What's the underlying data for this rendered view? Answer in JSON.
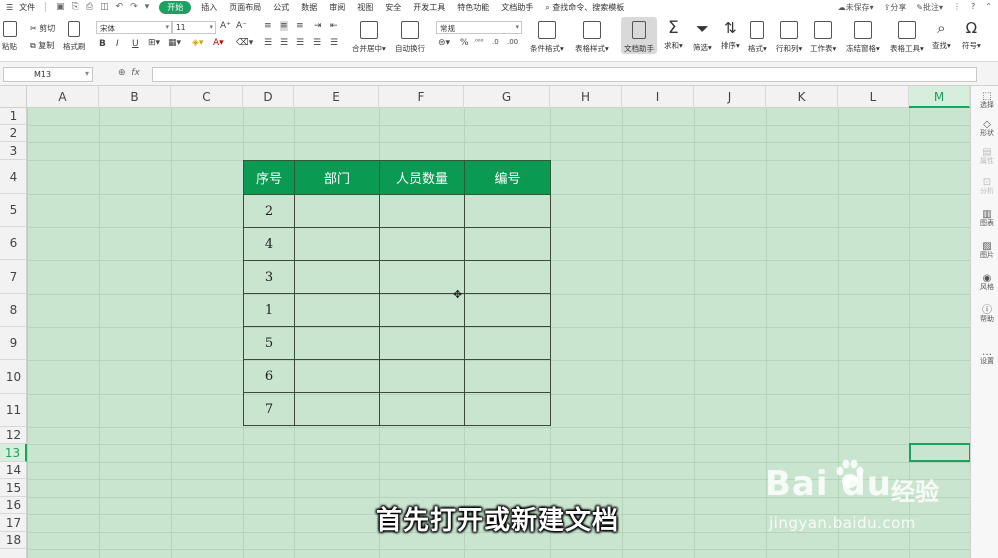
{
  "menubar": {
    "file": "文件",
    "tabs": [
      "开始",
      "插入",
      "页面布局",
      "公式",
      "数据",
      "审阅",
      "视图",
      "安全",
      "开发工具",
      "特色功能",
      "文档助手"
    ],
    "active_tab": "开始",
    "search_placeholder": "查找命令、搜索模板",
    "right": [
      "未保存",
      "分享",
      "批注"
    ]
  },
  "ribbon": {
    "paste": "粘贴",
    "cut": "剪切",
    "copy": "复制",
    "format_painter": "格式刷",
    "font_name": "宋体",
    "font_size": "11",
    "bold": "B",
    "italic": "I",
    "underline": "U",
    "merge_center": "合并居中",
    "wrap_text": "自动换行",
    "number_format": "常规",
    "percent": "%",
    "cond_format": "条件格式",
    "table_style": "表格样式",
    "doc_helper": "文档助手",
    "sum": "求和",
    "filter": "筛选",
    "sort": "排序",
    "format": "格式",
    "row_col": "行和列",
    "worksheet": "工作表",
    "freeze": "冻结窗格",
    "table_tools": "表格工具",
    "find": "查找",
    "symbol": "符号"
  },
  "formula_bar": {
    "cell_ref": "M13",
    "fx": "fx",
    "value": ""
  },
  "columns": [
    "A",
    "B",
    "C",
    "D",
    "E",
    "F",
    "G",
    "H",
    "I",
    "J",
    "K",
    "L",
    "M"
  ],
  "rows": [
    "1",
    "2",
    "3",
    "4",
    "5",
    "6",
    "7",
    "8",
    "9",
    "10",
    "11",
    "12",
    "13",
    "14",
    "15",
    "16",
    "17",
    "18"
  ],
  "selected_column": "M",
  "selected_row": "13",
  "table": {
    "headers": [
      "序号",
      "部门",
      "人员数量",
      "编号"
    ],
    "rows": [
      [
        "2",
        "",
        "",
        ""
      ],
      [
        "4",
        "",
        "",
        ""
      ],
      [
        "3",
        "",
        "",
        ""
      ],
      [
        "1",
        "",
        "",
        ""
      ],
      [
        "5",
        "",
        "",
        ""
      ],
      [
        "6",
        "",
        "",
        ""
      ],
      [
        "7",
        "",
        "",
        ""
      ]
    ],
    "header_color": "#0a9a52"
  },
  "side_panel": [
    "选择",
    "形状",
    "属性",
    "分析",
    "图表",
    "图片",
    "风格",
    "帮助",
    "设置"
  ],
  "caption": "首先打开或新建文档",
  "watermark": {
    "brand": "Bai  du",
    "cn": "经验",
    "url": "jingyan.baidu.com"
  },
  "colors": {
    "accent": "#1aa260",
    "grid_bg": "#c9e5cf"
  }
}
